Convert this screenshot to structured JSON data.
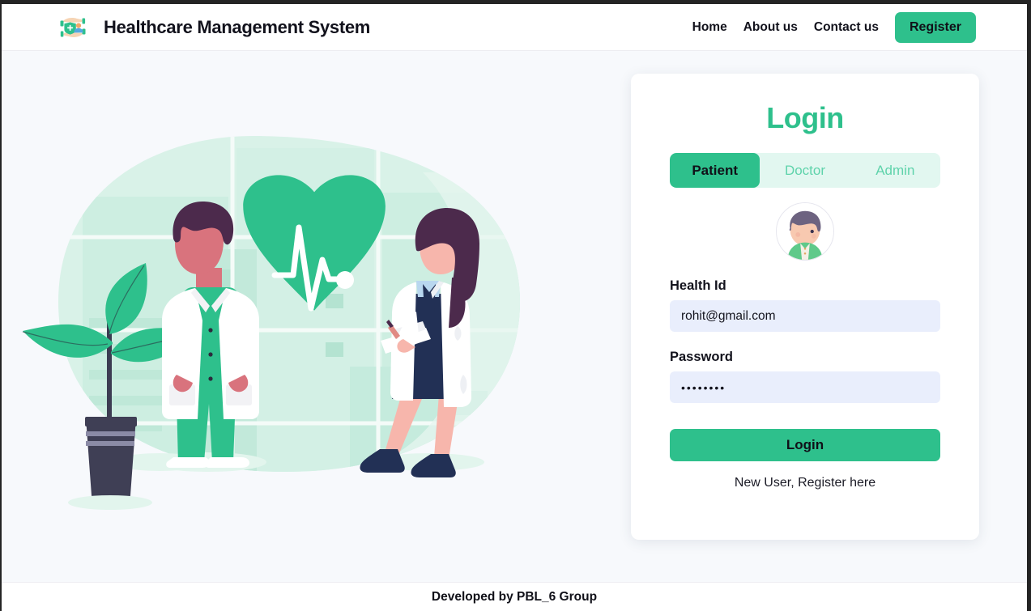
{
  "header": {
    "logo_icon": "hands-shield-care-icon",
    "brand_title": "Healthcare Management System",
    "nav": [
      {
        "label": "Home",
        "name": "nav-link-home"
      },
      {
        "label": "About us",
        "name": "nav-link-about-us"
      },
      {
        "label": "Contact us",
        "name": "nav-link-contact-us"
      }
    ],
    "register_label": "Register"
  },
  "hero": {
    "illustration_name": "healthcare-doctors-illustration",
    "elements": [
      "male-doctor",
      "female-doctor",
      "heart-ecg-icon",
      "potted-plant",
      "hospital-buildings"
    ]
  },
  "card": {
    "title": "Login",
    "tabs": [
      {
        "label": "Patient",
        "active": true
      },
      {
        "label": "Doctor",
        "active": false
      },
      {
        "label": "Admin",
        "active": false
      }
    ],
    "avatar_icon": "user-avatar-icon",
    "fields": {
      "health_id": {
        "label": "Health Id",
        "value": "rohit@gmail.com",
        "placeholder": "Health Id"
      },
      "password": {
        "label": "Password",
        "value": "••••••••",
        "placeholder": "Password"
      }
    },
    "login_label": "Login",
    "register_prompt": "New User, Register here"
  },
  "footer": {
    "text": "Developed by PBL_6 Group"
  },
  "colors": {
    "accent_green": "#2ec08c",
    "tab_inactive_bg": "#e2f7f0",
    "tab_inactive_text": "#5fd3ab",
    "input_bg": "#e9eefc",
    "page_bg": "#f7f9fc",
    "text_dark": "#12121c"
  }
}
